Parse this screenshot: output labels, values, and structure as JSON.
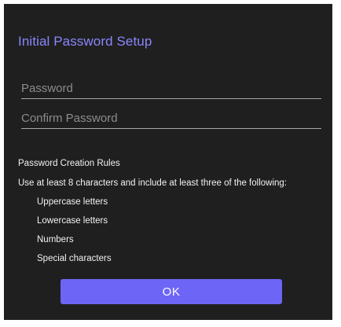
{
  "dialog": {
    "title": "Initial Password Setup",
    "password_field": {
      "placeholder": "Password",
      "value": ""
    },
    "confirm_field": {
      "placeholder": "Confirm Password",
      "value": ""
    },
    "rules": {
      "heading": "Password Creation Rules",
      "intro": "Use at least 8 characters and include at least three of the following:",
      "items": [
        "Uppercase letters",
        "Lowercase letters",
        "Numbers",
        "Special characters"
      ]
    },
    "ok_label": "OK"
  },
  "colors": {
    "background": "#1f1f1f",
    "title": "#8b86ff",
    "button": "#6d65f5"
  }
}
